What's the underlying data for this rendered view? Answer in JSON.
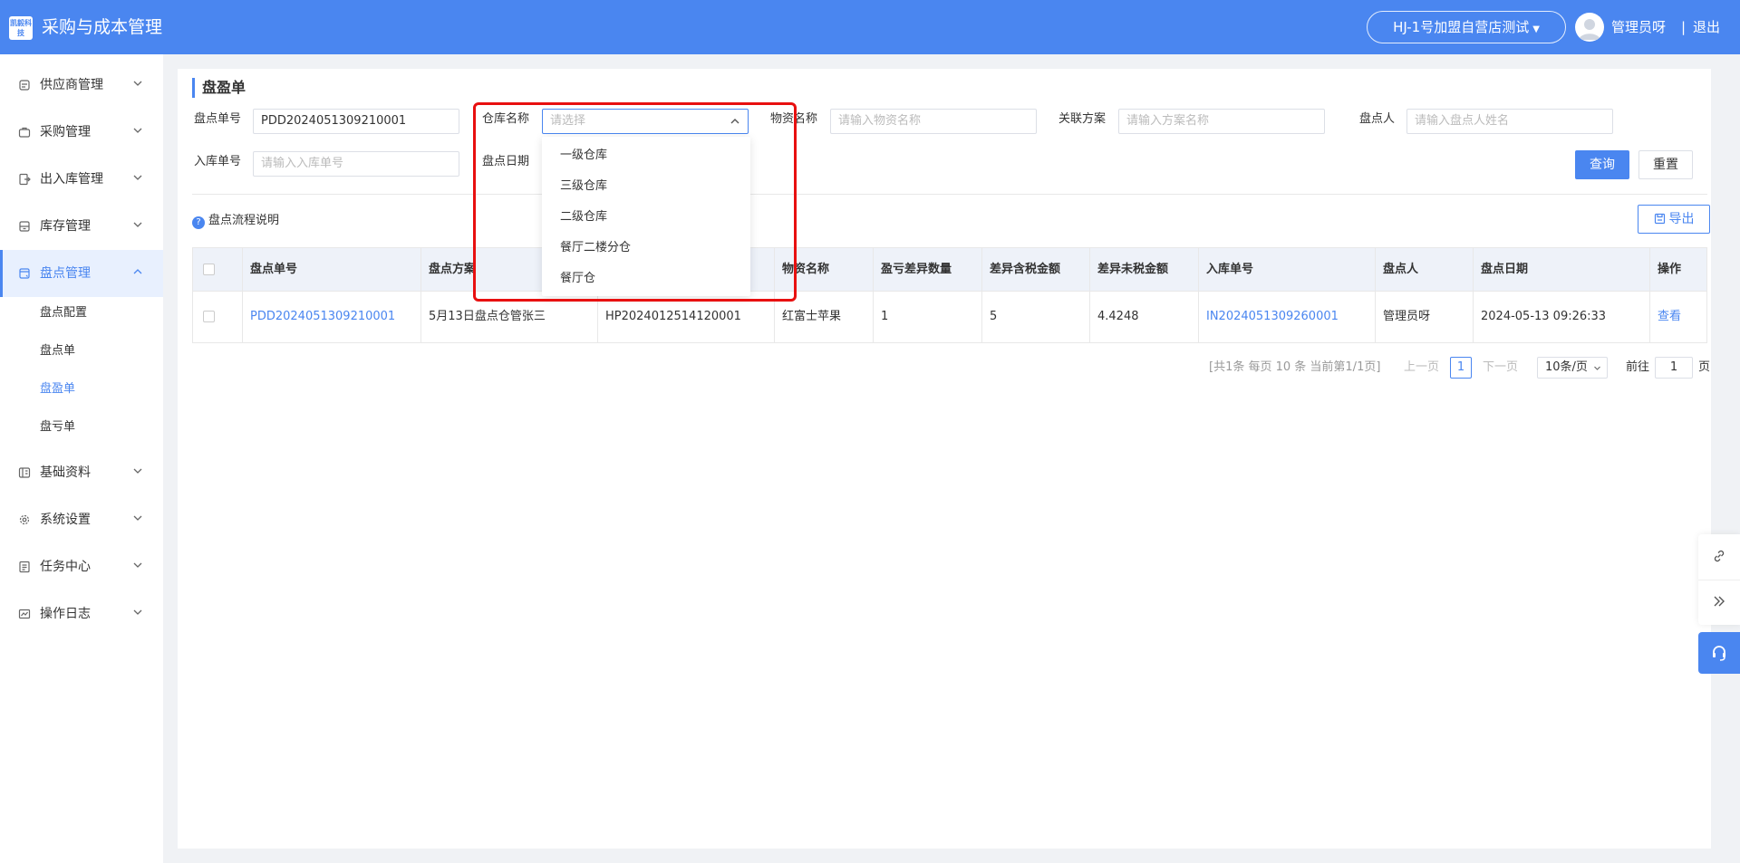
{
  "header": {
    "logo_text": "凯毅科技",
    "app_title": "采购与成本管理",
    "store_selector": "HJ-1号加盟自营店测试",
    "user_name": "管理员呀",
    "separator": "|",
    "logout": "退出"
  },
  "sidebar": {
    "items": [
      {
        "label": "供应商管理",
        "icon": "supplier-icon"
      },
      {
        "label": "采购管理",
        "icon": "purchase-icon"
      },
      {
        "label": "出入库管理",
        "icon": "inout-icon"
      },
      {
        "label": "库存管理",
        "icon": "inventory-icon"
      },
      {
        "label": "盘点管理",
        "icon": "stocktake-icon"
      },
      {
        "label": "基础资料",
        "icon": "basic-data-icon"
      },
      {
        "label": "系统设置",
        "icon": "gear-icon"
      },
      {
        "label": "任务中心",
        "icon": "task-icon"
      },
      {
        "label": "操作日志",
        "icon": "log-icon"
      }
    ],
    "sub_items": [
      "盘点配置",
      "盘点单",
      "盘盈单",
      "盘亏单"
    ]
  },
  "page": {
    "title": "盘盈单"
  },
  "filters": {
    "stocktake_no": {
      "label": "盘点单号",
      "value": "PDD2024051309210001"
    },
    "warehouse": {
      "label": "仓库名称",
      "placeholder": "请选择"
    },
    "material": {
      "label": "物资名称",
      "placeholder": "请输入物资名称"
    },
    "plan": {
      "label": "关联方案",
      "placeholder": "请输入方案名称"
    },
    "counter": {
      "label": "盘点人",
      "placeholder": "请输入盘点人姓名"
    },
    "inbound_no": {
      "label": "入库单号",
      "placeholder": "请输入入库单号"
    },
    "date": {
      "label": "盘点日期"
    },
    "query_button": "查询",
    "reset_button": "重置"
  },
  "help_text": "盘点流程说明",
  "export_button": "导出",
  "warehouse_options": [
    "一级仓库",
    "三级仓库",
    "二级仓库",
    "餐厅二楼分仓",
    "餐厅仓"
  ],
  "table": {
    "columns": [
      "盘点单号",
      "盘点方案",
      "",
      "物资名称",
      "盈亏差异数量",
      "差异含税金额",
      "差异未税金额",
      "入库单号",
      "盘点人",
      "盘点日期",
      "操作"
    ],
    "rows": [
      {
        "stocktake_no": "PDD2024051309210001",
        "plan": "5月13日盘点仓管张三",
        "code": "HP2024012514120001",
        "material": "红富士苹果",
        "qty_diff": "1",
        "amount_tax": "5",
        "amount_notax": "4.4248",
        "inbound_no": "IN2024051309260001",
        "counter": "管理员呀",
        "date": "2024-05-13 09:26:33",
        "action": "查看"
      }
    ]
  },
  "pagination": {
    "summary": "[共1条 每页 10 条 当前第1/1页]",
    "prev": "上一页",
    "current": "1",
    "next": "下一页",
    "page_size": "10条/页",
    "goto_label": "前往",
    "goto_value": "1",
    "page_unit": "页"
  },
  "colors": {
    "primary": "#4a86f0",
    "highlight": "#e81010"
  }
}
